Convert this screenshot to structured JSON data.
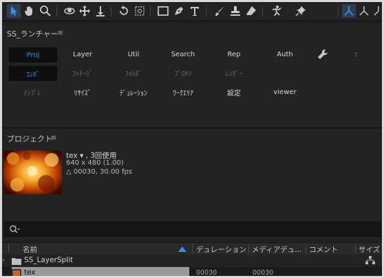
{
  "launcher": {
    "title": "SS_ランチャー",
    "menu_icon": "≡",
    "row1": [
      "Proj",
      "Layer",
      "Util",
      "Search",
      "Rep",
      "Auth"
    ],
    "row2": [
      "ｺﾝﾎﾟ",
      "ﾌｯﾃｰｼﾞ",
      "ﾌｫﾙﾀﾞ",
      "ﾌﾟﾛｷｼ",
      "ﾚﾝﾀﾞｰ"
    ],
    "row3": [
      "ﾃﾝﾌﾟﾚ",
      "ﾘｻｲｽﾞ",
      "ﾃﾞｭﾚｰｼｮﾝ",
      "ﾜｰｸｴﾘｱ",
      "設定",
      "viewer"
    ],
    "wrench_icon": "wrench-icon",
    "more": ":"
  },
  "project": {
    "title": "プロジェクト",
    "menu_icon": "≡",
    "item_name": "tex ▾ , 3回使用",
    "item_size": "640 x 480 (1.00)",
    "item_duration": "△ 00030, 30.00 fps",
    "search_placeholder": "",
    "columns": {
      "name": "名前",
      "duration": "デュレーション",
      "media_duration": "メディアデュ...",
      "comment": "コメント",
      "size": "サイズ"
    },
    "rows": [
      {
        "name": "SS_LayerSplit",
        "type": "folder",
        "duration": "",
        "media": ""
      },
      {
        "name": "tex",
        "type": "footage",
        "duration": "00030",
        "media": "00030"
      }
    ]
  },
  "colors": {
    "accent": "#3d8ee6",
    "panel": "#232323",
    "selected_row": "#9a9a9a"
  }
}
